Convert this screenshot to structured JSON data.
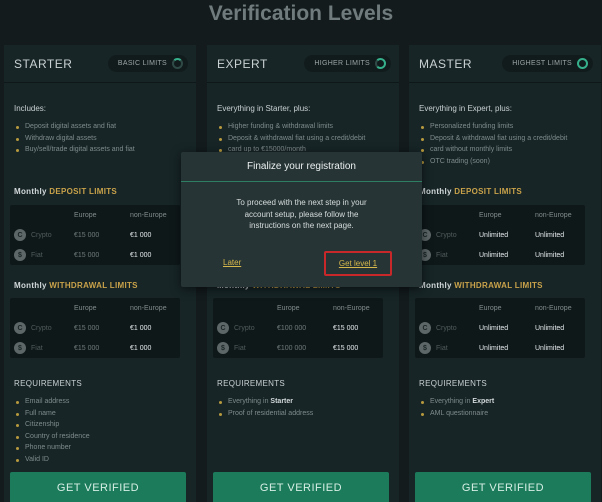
{
  "page_title": "Verification Levels",
  "colors": {
    "background": "#131b1d",
    "card": "#172527",
    "gold": "#c9a24a",
    "green": "#1c7b5b",
    "highlight_border": "#c8282a"
  },
  "table_headers": {
    "europe": "Europe",
    "non_europe": "non-Europe"
  },
  "row_labels": {
    "crypto": "Crypto",
    "fiat": "Fiat"
  },
  "sections": {
    "monthly": "Monthly",
    "deposit": "DEPOSIT LIMITS",
    "withdrawal": "WITHDRAWAL LIMITS",
    "requirements": "REQUIREMENTS"
  },
  "button_label": "GET VERIFIED",
  "cards": [
    {
      "name": "STARTER",
      "pill": "BASIC LIMITS",
      "intro": "Includes:",
      "features": [
        "Deposit digital assets and fiat",
        "Withdraw digital assets",
        "Buy/sell/trade digital assets and fiat"
      ],
      "deposit": {
        "crypto": [
          "€15 000",
          "€1 000"
        ],
        "fiat": [
          "€15 000",
          "€1 000"
        ]
      },
      "withdrawal": {
        "crypto": [
          "€15 000",
          "€1 000"
        ],
        "fiat": [
          "€15 000",
          "€1 000"
        ]
      },
      "requirements": [
        "Email address",
        "Full name",
        "Citizenship",
        "Country of residence",
        "Phone number",
        "Valid ID"
      ]
    },
    {
      "name": "EXPERT",
      "pill": "HIGHER LIMITS",
      "intro": "Everything in Starter, plus:",
      "features": [
        "Higher funding & withdrawal limits",
        "Deposit & withdrawal fiat using a credit/debit",
        "card up to €15000/month"
      ],
      "deposit": {
        "crypto": [
          "",
          ""
        ],
        "fiat": [
          "",
          ""
        ]
      },
      "withdrawal": {
        "crypto": [
          "€100 000",
          "€15 000"
        ],
        "fiat": [
          "€100 000",
          "€15 000"
        ]
      },
      "requirements_prefix": "Everything in",
      "requirements_bold": "Starter",
      "requirements": [
        "Proof of residential address"
      ]
    },
    {
      "name": "MASTER",
      "pill": "HIGHEST LIMITS",
      "intro": "Everything in Expert, plus:",
      "features": [
        "Personalized funding limits",
        "Deposit & withdrawal fiat using a credit/debit",
        "card without monthly limits",
        "OTC trading (soon)"
      ],
      "deposit": {
        "crypto": [
          "Unlimited",
          "Unlimited"
        ],
        "fiat": [
          "Unlimited",
          "Unlimited"
        ]
      },
      "withdrawal": {
        "crypto": [
          "Unlimited",
          "Unlimited"
        ],
        "fiat": [
          "Unlimited",
          "Unlimited"
        ]
      },
      "requirements_prefix": "Everything in",
      "requirements_bold": "Expert",
      "requirements": [
        "AML questionnaire"
      ]
    }
  ],
  "modal": {
    "title": "Finalize your registration",
    "line1": "To proceed with the next step in your",
    "line2": "account setup, please follow the",
    "line3": "instructions on the next page.",
    "later": "Later",
    "get_level": "Get level 1"
  }
}
